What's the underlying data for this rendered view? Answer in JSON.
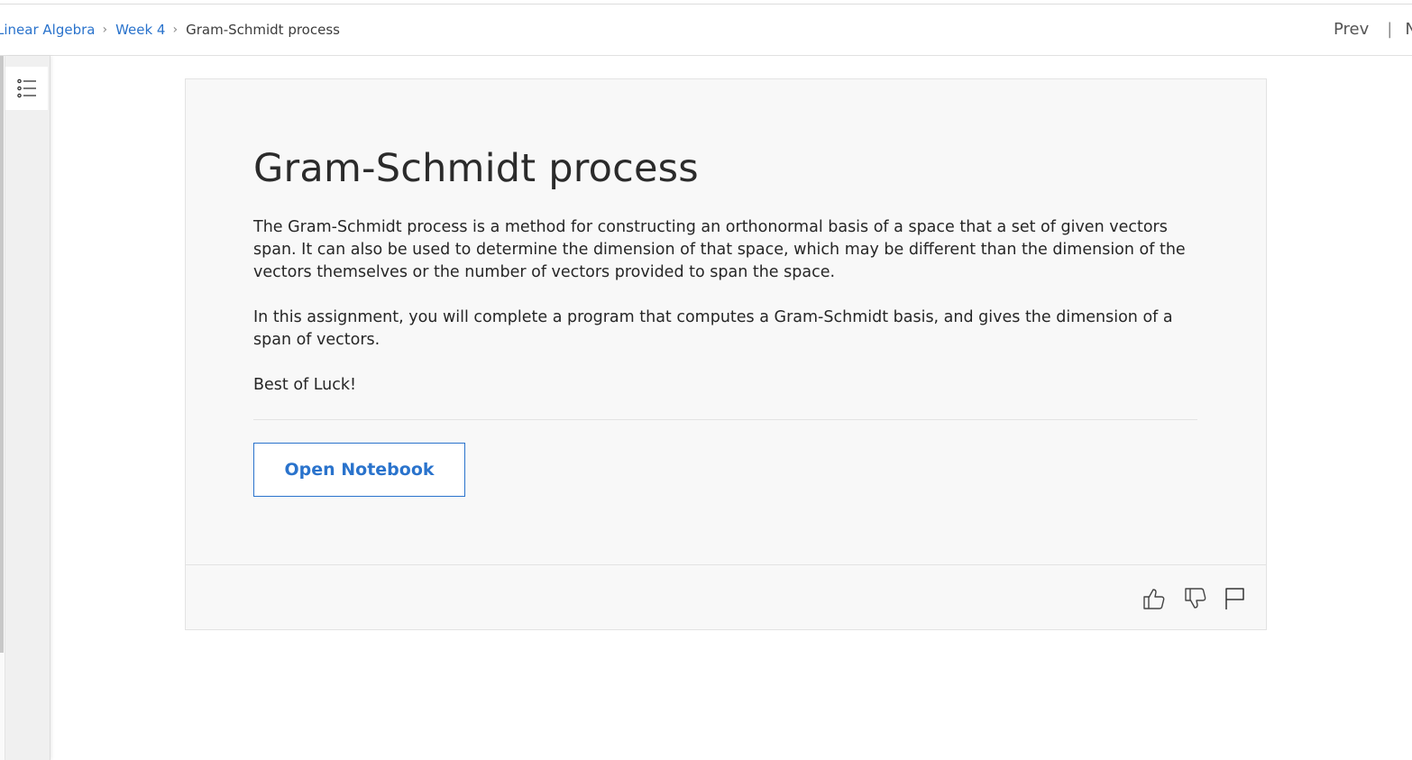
{
  "header": {
    "breadcrumb": [
      {
        "label": "Linear Algebra",
        "link": true
      },
      {
        "label": "Week 4",
        "link": true
      },
      {
        "label": "Gram-Schmidt process",
        "link": false
      }
    ],
    "prev_label": "Prev",
    "separator": "|",
    "next_label_partial": "N"
  },
  "sidebar": {
    "toc_icon": "list-icon"
  },
  "content": {
    "title": "Gram-Schmidt process",
    "paragraphs": [
      "The Gram-Schmidt process is a method for constructing an orthonormal basis of a space that a set of given vectors span. It can also be used to determine the dimension of that space, which may be different than the dimension of the vectors themselves or the number of vectors provided to span the space.",
      "In this assignment, you will complete a program that computes a Gram-Schmidt basis, and gives the dimension of a span of vectors.",
      "Best of Luck!"
    ],
    "open_button_label": "Open Notebook"
  },
  "footer_icons": [
    "thumbs-up-icon",
    "thumbs-down-icon",
    "flag-icon"
  ],
  "colors": {
    "link": "#2a73cc",
    "card_bg": "#f8f8f8",
    "sidebar_bg": "#f0f0f0"
  }
}
